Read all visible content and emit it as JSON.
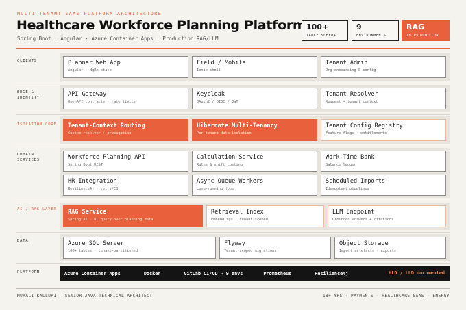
{
  "header": {
    "eyebrow": "MULTI-TENANT SAAS PLATFORM ARCHITECTURE",
    "title": "Healthcare Workforce Planning Platform",
    "subtitle": "Spring Boot · Angular · Azure Container Apps · Production RAG/LLM"
  },
  "stats": [
    {
      "value": "100+",
      "label": "TABLE SCHEMA"
    },
    {
      "value": "9",
      "label": "ENVIRONMENTS"
    },
    {
      "value": "RAG",
      "label": "IN PRODUCTION"
    }
  ],
  "rows": {
    "clients": {
      "label": "CLIENTS",
      "cards": [
        {
          "title": "Planner Web App",
          "sub": "Angular · NgRx state"
        },
        {
          "title": "Field / Mobile",
          "sub": "Ionic shell"
        },
        {
          "title": "Tenant Admin",
          "sub": "Org onboarding & config"
        }
      ]
    },
    "edge": {
      "label": "EDGE & IDENTITY",
      "cards": [
        {
          "title": "API Gateway",
          "sub": "OpenAPI contracts · rate limits"
        },
        {
          "title": "Keycloak",
          "sub": "OAuth2 / OIDC / JWT"
        },
        {
          "title": "Tenant Resolver",
          "sub": "Request → tenant context"
        }
      ]
    },
    "isolation": {
      "label": "ISOLATION CORE",
      "cards": [
        {
          "title": "Tenant-Context Routing",
          "sub": "Custom resolver + propagation"
        },
        {
          "title": "Hibernate Multi-Tenancy",
          "sub": "Per-tenant data isolation"
        },
        {
          "title": "Tenant Config Registry",
          "sub": "Feature flags · entitlements"
        }
      ]
    },
    "domain": {
      "label": "DOMAIN SERVICES",
      "cards": [
        {
          "title": "Workforce Planning API",
          "sub": "Spring Boot REST"
        },
        {
          "title": "Calculation Service",
          "sub": "Rules & shift costing"
        },
        {
          "title": "Work-Time Bank",
          "sub": "Balance ledger"
        },
        {
          "title": "HR Integration",
          "sub": "Resilience4j · retry/CB"
        },
        {
          "title": "Async Queue Workers",
          "sub": "Long-running jobs"
        },
        {
          "title": "Scheduled Imports",
          "sub": "Idempotent pipelines"
        }
      ]
    },
    "ai": {
      "label": "AI / RAG LAYER",
      "cards": [
        {
          "title": "RAG Service",
          "sub": "Spring AI · NL query over planning data"
        },
        {
          "title": "Retrieval Index",
          "sub": "Embeddings · tenant-scoped"
        },
        {
          "title": "LLM Endpoint",
          "sub": "Grounded answers + citations"
        }
      ]
    },
    "data": {
      "label": "DATA",
      "cards": [
        {
          "title": "Azure SQL Server",
          "sub": "100+ tables · tenant-partitioned"
        },
        {
          "title": "Flyway",
          "sub": "Tenant-scoped migrations"
        },
        {
          "title": "Object Storage",
          "sub": "Import artefacts · exports"
        }
      ]
    },
    "platform": {
      "label": "PLATFORM",
      "items": [
        "Azure Container Apps",
        "Docker",
        "GitLab CI/CD → 9 envs",
        "Prometheus",
        "Resilience4j"
      ],
      "accent_item": "HLD / LLD documented"
    }
  },
  "footer": {
    "left": "MURALI KALLURI — SENIOR JAVA TECHNICAL ARCHITECT",
    "right": "18+ YRS · PAYMENTS · HEALTHCARE SAAS · ENERGY"
  },
  "colors": {
    "accent": "#e8603c",
    "background": "#f5f3ee",
    "platform_bar": "#141414"
  }
}
